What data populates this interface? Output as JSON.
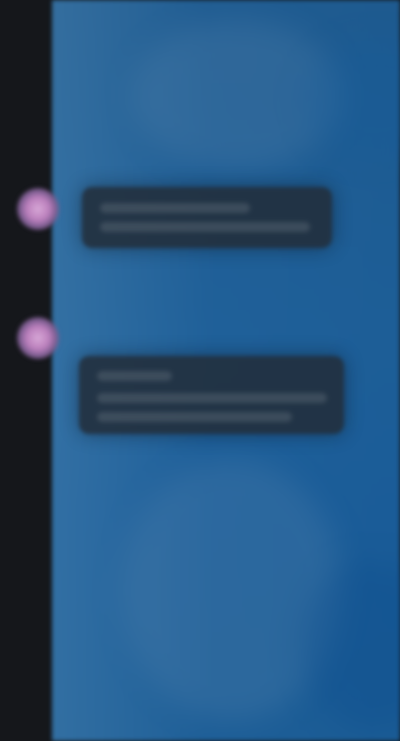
{
  "colors": {
    "sidebar": "#15171b",
    "panel": "#1d5e97",
    "bubble": "#222d3a",
    "avatar": "#c891c8"
  },
  "messages": [
    {
      "avatar": "avatar",
      "text": ""
    },
    {
      "avatar": "avatar",
      "text": ""
    }
  ]
}
